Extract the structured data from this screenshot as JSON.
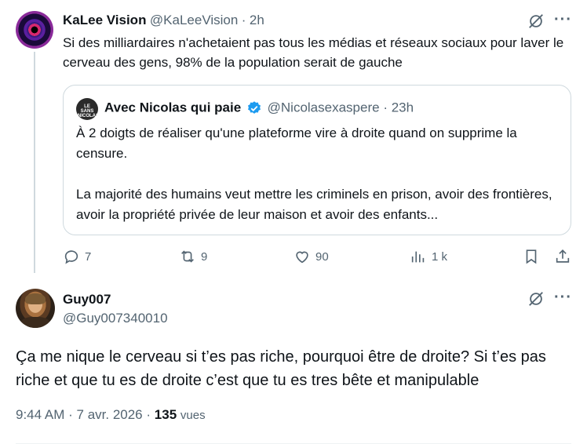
{
  "tweet1": {
    "author_name": "KaLee Vision",
    "handle": "@KaLeeVision",
    "separator": "·",
    "time": "2h",
    "text": "Si des milliardaires n'achetaient pas tous les médias et réseaux sociaux pour laver le cerveau des gens, 98% de la population serait de gauche",
    "more_label": "···",
    "quote": {
      "avatar_text": "LE SANS NICOLAS",
      "author_name": "Avec Nicolas qui paie",
      "handle": "@Nicolasexaspere",
      "separator": "·",
      "time": "23h",
      "paragraph1": "À 2 doigts de réaliser qu'une plateforme vire à droite quand on supprime la censure.",
      "paragraph2": "La majorité des humains veut mettre les criminels en prison, avoir des frontières, avoir la propriété privée de leur maison et avoir des enfants..."
    },
    "actions": {
      "replies": "7",
      "reposts": "9",
      "likes": "90",
      "views": "1 k"
    }
  },
  "tweet2": {
    "author_name": "Guy007",
    "handle": "@Guy007340010",
    "more_label": "···",
    "text": "Ça me nique le cerveau si t’es pas riche, pourquoi être de droite? Si t’es pas riche et que tu es de droite c’est que tu es tres bête et manipulable",
    "time": "9:44 AM",
    "separator1": "·",
    "date": "7 avr. 2026",
    "separator2": "·",
    "views_count": "135",
    "views_label": "vues"
  },
  "colors": {
    "text": "#0f1419",
    "secondary": "#536471",
    "border": "#cfd9de",
    "verified": "#1d9bf0"
  },
  "icons": [
    "grok-icon",
    "more-icon",
    "reply-icon",
    "repost-icon",
    "like-icon",
    "views-icon",
    "bookmark-icon",
    "share-icon",
    "verified-badge-icon"
  ]
}
